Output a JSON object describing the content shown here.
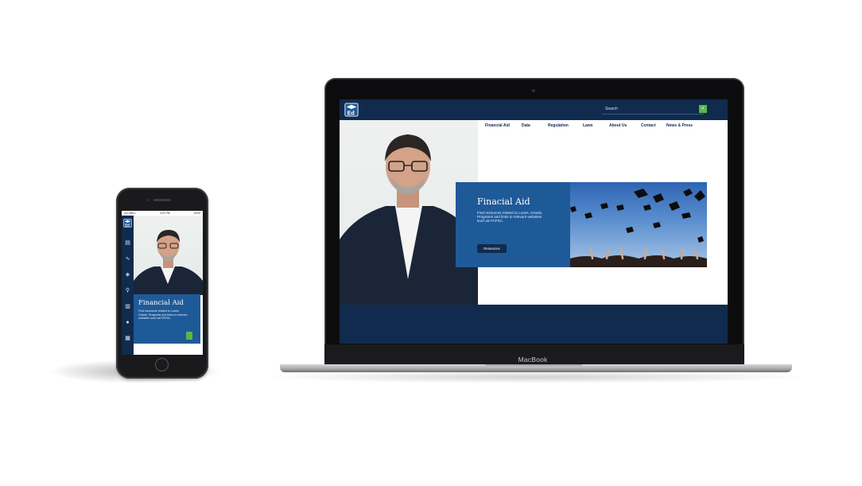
{
  "phone": {
    "status_left": "••••• BELL ",
    "status_time": "4:21 PM",
    "status_right": "100%",
    "card": {
      "title": "Financial Aid",
      "text": "Find resources related to Loans, Grants, Programs and links to relevant websites such as FAFSA."
    },
    "sidebar_icons": [
      "document-icon",
      "chart-line-icon",
      "shield-icon",
      "runner-icon",
      "bank-icon",
      "gear-icon",
      "clipboard-icon"
    ]
  },
  "laptop": {
    "brand": "MacBook",
    "search": {
      "placeholder": "Search"
    },
    "nav": [
      "Financial Aid",
      "Data",
      "Regulation",
      "Laws",
      "About Us",
      "Contact",
      "News & Press"
    ],
    "hero": {
      "title": "Finacial Aid",
      "text": "Find resources related to Loans, Grants, Programs and links to relevant websites such as FAFSA.",
      "button": "Resources"
    }
  },
  "colors": {
    "navy": "#102b4e",
    "blue": "#1f5a98",
    "green": "#59b847"
  }
}
